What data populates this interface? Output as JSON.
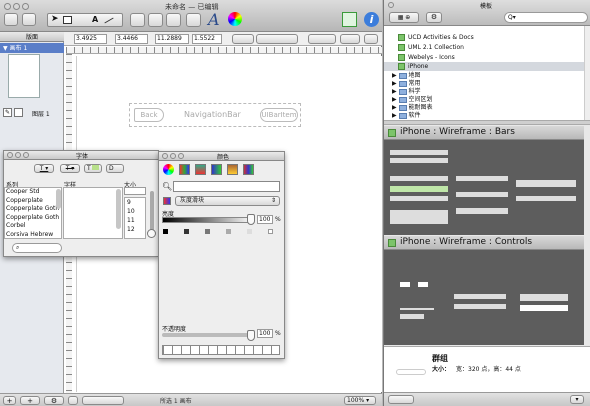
{
  "main": {
    "title": "未命名 — 已编辑",
    "left_header": "版面",
    "canvas_title": "画布 1",
    "layer": "图层 1",
    "inspector": {
      "x": "3.4925",
      "y": "3.4466",
      "w": "11.2889",
      "h": "1.5522"
    },
    "status": "所选 1 画布",
    "zoom": "100%",
    "nav": {
      "back": "Back",
      "title": "NavigationBar",
      "item": "UIBarItem"
    }
  },
  "fonts": {
    "title": "字体",
    "col_family": "系列",
    "col_face": "字样",
    "col_size": "大小",
    "families": [
      "Cooper Std",
      "Copperplate",
      "Copperplate Goth",
      "Copperplate Goth",
      "Corbel",
      "Corsiva Hebrew"
    ],
    "sizes": [
      "9",
      "10",
      "11",
      "12"
    ]
  },
  "colors": {
    "title": "颜色",
    "mode": "灰度滑块",
    "brightness_label": "亮度",
    "brightness_value": "100",
    "opacity_label": "不透明度",
    "opacity_value": "100",
    "percent": "%"
  },
  "stencils": {
    "title": "模板",
    "search_placeholder": "Q▾",
    "libraries": [
      "UCD Activities & Docs",
      "UML 2.1 Collection",
      "Webelys - Icons",
      "iPhone"
    ],
    "folders": [
      "地图",
      "常用",
      "科学",
      "空间区划",
      "能耐图表",
      "软件"
    ],
    "sec1": "iPhone : Wireframe : Bars",
    "sec2": "iPhone : Wireframe : Controls",
    "group_title": "群组",
    "size_label": "大小：",
    "size_value": "宽：320 点，高：44 点"
  }
}
